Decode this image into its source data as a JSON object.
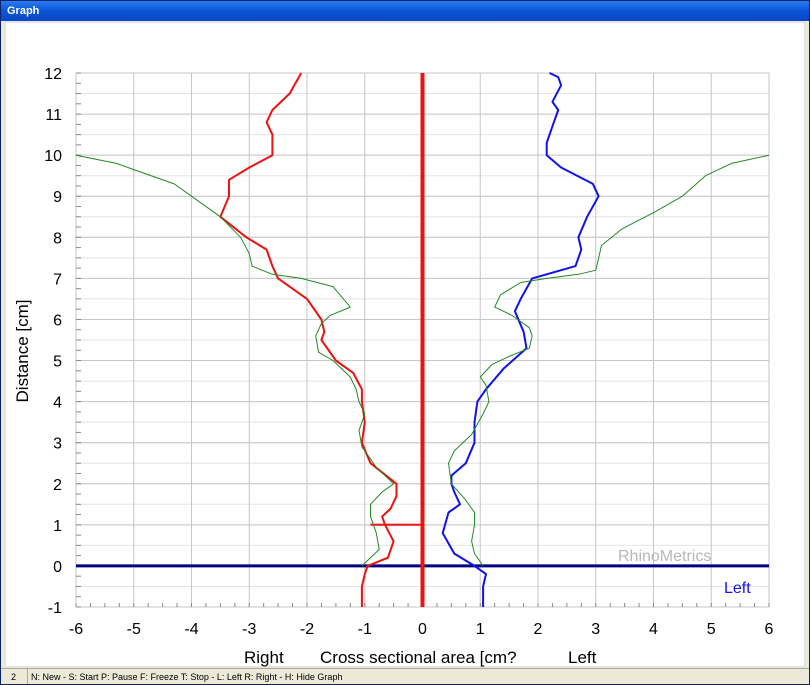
{
  "window": {
    "title": "Graph"
  },
  "status": {
    "number": "2",
    "help": "N: New  -  S: Start  P: Pause  F: Freeze  T: Stop  -  L: Left  R: Right  -  H: Hide Graph"
  },
  "chart_data": {
    "type": "line",
    "xlabel": "Cross sectional area [cm?",
    "ylabel": "Distance [cm]",
    "xlim": [
      -6,
      6
    ],
    "ylim": [
      -1,
      12
    ],
    "xticks": [
      -6,
      -5,
      -4,
      -3,
      -2,
      -1,
      0,
      1,
      2,
      3,
      4,
      5,
      6
    ],
    "yticks": [
      -1,
      0,
      1,
      2,
      3,
      4,
      5,
      6,
      7,
      8,
      9,
      10,
      11,
      12
    ],
    "grid": true,
    "annotations": {
      "right_label": "Right",
      "left_label": "Left",
      "watermark": "RhinoMetrics"
    },
    "colors": {
      "right": "#ee1111",
      "left": "#1111ee",
      "model": "#228822",
      "baseline": "#000080",
      "zero_line": "#ee1111",
      "watermark": "#b8b8b8"
    },
    "series": [
      {
        "color": "#ee1111",
        "x": [
          -1.05,
          -1.05,
          -1.0,
          -0.95,
          -0.6,
          -0.5,
          -0.65,
          -0.7,
          -0.55,
          -0.45,
          -0.45,
          -0.9,
          -1.05,
          -1.0,
          -1.05,
          -1.05,
          -1.05,
          -1.2,
          -1.5,
          -1.75,
          -1.7,
          -1.75,
          -2.0,
          -2.5,
          -2.6,
          -2.7,
          -3.05,
          -3.5,
          -3.35,
          -3.35,
          -3.0,
          -2.6,
          -2.6,
          -2.7,
          -2.6,
          -2.3,
          -2.1
        ],
        "y": [
          -1,
          -0.5,
          -0.2,
          0,
          0.2,
          0.6,
          1.0,
          1.2,
          1.4,
          1.7,
          2.0,
          2.5,
          3.0,
          3.5,
          4.0,
          4.1,
          4.3,
          4.7,
          5.0,
          5.5,
          5.7,
          6.0,
          6.5,
          7.0,
          7.3,
          7.7,
          8.0,
          8.5,
          9.0,
          9.4,
          9.7,
          10.0,
          10.5,
          10.8,
          11.1,
          11.5,
          12.0
        ]
      },
      {
        "color": "#ee1111",
        "x": [
          -0.9,
          0
        ],
        "y": [
          1.0,
          1.0
        ]
      },
      {
        "color": "#1111ee",
        "x": [
          1.05,
          1.05,
          1.1,
          0.9,
          0.55,
          0.35,
          0.45,
          0.65,
          0.55,
          0.5,
          0.5,
          0.75,
          0.9,
          0.9,
          0.95,
          1.1,
          1.4,
          1.8,
          1.75,
          1.6,
          1.7,
          1.9,
          2.65,
          2.75,
          2.7,
          2.85,
          3.05,
          2.95,
          2.4,
          2.15,
          2.15,
          2.25,
          2.35,
          2.25,
          2.4,
          2.35,
          2.2
        ],
        "y": [
          -1,
          -0.5,
          -0.2,
          0,
          0.3,
          0.8,
          1.3,
          1.5,
          1.8,
          2.0,
          2.2,
          2.5,
          3.0,
          3.5,
          4.0,
          4.3,
          4.8,
          5.3,
          5.7,
          6.2,
          6.5,
          7.0,
          7.3,
          7.7,
          8.0,
          8.5,
          9.0,
          9.3,
          9.7,
          10.0,
          10.3,
          10.7,
          11.1,
          11.3,
          11.7,
          11.9,
          12.0
        ]
      },
      {
        "color": "#228822",
        "x": [
          -1.05,
          -0.75,
          -0.8,
          -0.9,
          -0.9,
          -0.7,
          -0.5,
          -0.8,
          -1.05,
          -1.1,
          -1.0,
          -1.1,
          -1.15,
          -1.25,
          -1.55,
          -1.8,
          -1.85,
          -1.75,
          -1.6,
          -1.25,
          -1.55,
          -2.1,
          -2.6,
          -2.95,
          -3.0,
          -3.15,
          -3.5,
          -3.9,
          -4.3,
          -4.9,
          -5.3,
          -6.0
        ],
        "y": [
          0,
          0.4,
          0.8,
          1.2,
          1.5,
          1.8,
          2.0,
          2.4,
          2.9,
          3.3,
          3.7,
          4.0,
          4.3,
          4.6,
          5.0,
          5.2,
          5.6,
          5.9,
          6.1,
          6.3,
          6.8,
          7.0,
          7.1,
          7.3,
          7.6,
          8.0,
          8.5,
          8.9,
          9.3,
          9.6,
          9.8,
          10.0
        ]
      },
      {
        "color": "#228822",
        "x": [
          1.05,
          0.9,
          0.85,
          0.9,
          0.9,
          0.75,
          0.5,
          0.45,
          0.55,
          0.85,
          1.05,
          1.15,
          1.1,
          1.0,
          1.2,
          1.5,
          1.85,
          1.9,
          1.85,
          1.55,
          1.25,
          1.35,
          1.7,
          2.15,
          2.7,
          3.0,
          3.1,
          3.45,
          4.0,
          4.5,
          4.9,
          5.35,
          6.0
        ],
        "y": [
          0,
          0.3,
          0.6,
          1.0,
          1.3,
          1.6,
          2.0,
          2.5,
          2.8,
          3.2,
          3.7,
          4.0,
          4.4,
          4.6,
          4.9,
          5.1,
          5.3,
          5.6,
          5.8,
          6.1,
          6.3,
          6.6,
          6.9,
          7.0,
          7.1,
          7.2,
          7.8,
          8.2,
          8.6,
          9.0,
          9.5,
          9.8,
          10.0
        ]
      }
    ]
  }
}
